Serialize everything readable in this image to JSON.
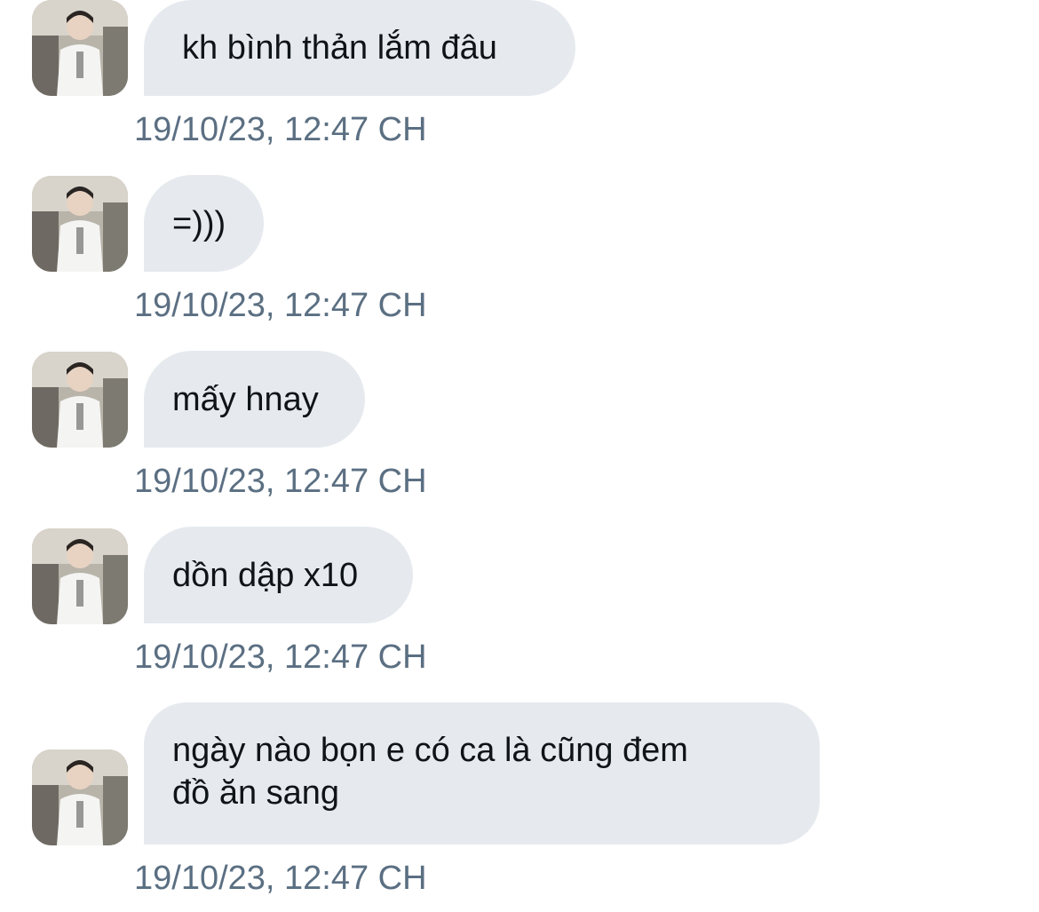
{
  "messages": [
    {
      "text": "kh bình thản lắm đâu",
      "timestamp": "19/10/23, 12:47 CH"
    },
    {
      "text": "=)))",
      "timestamp": "19/10/23, 12:47 CH"
    },
    {
      "text": "mấy hnay",
      "timestamp": "19/10/23, 12:47 CH"
    },
    {
      "text": "dồn dập x10",
      "timestamp": "19/10/23, 12:47 CH"
    },
    {
      "text_line1": "ngày nào bọn e có ca là cũng đem",
      "text_line2": "đồ ăn sang",
      "timestamp": "19/10/23, 12:47 CH"
    }
  ]
}
